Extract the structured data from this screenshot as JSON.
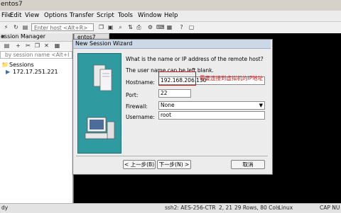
{
  "window": {
    "title": "entos7"
  },
  "menu": [
    "File",
    "Edit",
    "View",
    "Options",
    "Transfer",
    "Script",
    "Tools",
    "Window",
    "Help"
  ],
  "toolbar": {
    "host_placeholder": "Enter host <Alt+R>"
  },
  "session_manager": {
    "title": "ession Manager",
    "filter_placeholder": "by session name <Alt+I",
    "tree": {
      "root": "Sessions",
      "item": "172.17.251.221"
    }
  },
  "terminal_tab": "entos7",
  "dialog": {
    "title": "New Session Wizard",
    "question": "What is the name or IP address of the remote host?",
    "hint": "The user name can be left blank.",
    "hostname_label": "Hostname:",
    "hostname_value": "192.168.206.130",
    "annotation": "需要连接到虚拟机的IP地址",
    "port_label": "Port:",
    "port_value": "22",
    "firewall_label": "Firewall:",
    "firewall_value": "None",
    "username_label": "Username:",
    "username_value": "root",
    "back_label": "< 上一步(B)",
    "next_label": "下一步(N) >",
    "cancel_label": "取消"
  },
  "status": {
    "left": "dy",
    "cipher": "ssh2: AES-256-CTR",
    "pos": "2, 21",
    "size": "29 Rows, 80 Cols",
    "os": "Linux",
    "caps": "CAP NU"
  }
}
